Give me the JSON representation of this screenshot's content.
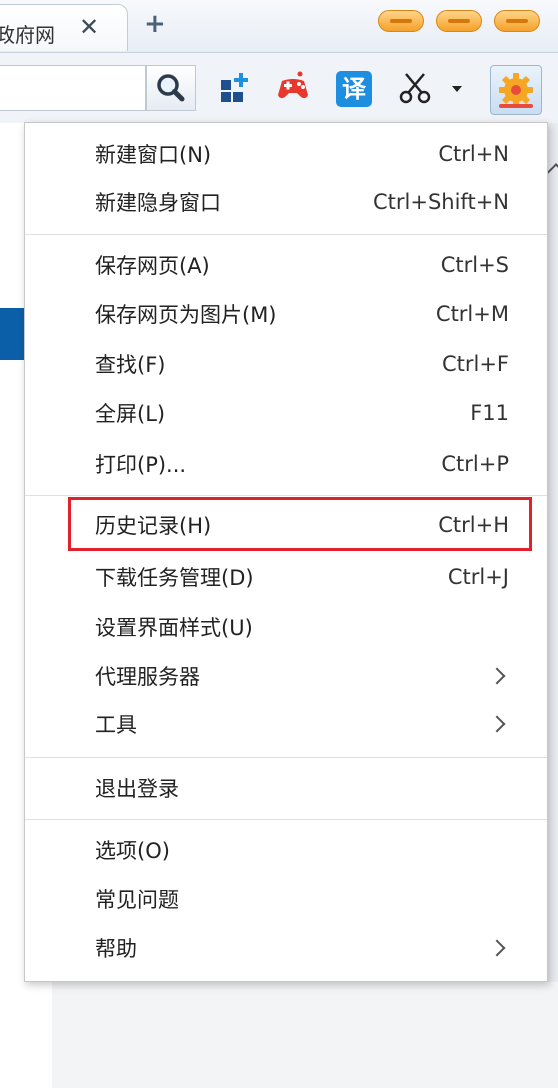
{
  "tab": {
    "title": "政府网",
    "close_glyph": "✕",
    "new_tab_glyph": "+"
  },
  "toolbar": {
    "icons": [
      "search-icon",
      "apps-icon",
      "game-icon",
      "translate-icon",
      "screenshot-icon",
      "settings-icon"
    ],
    "translate_label": "译",
    "dropdown_glyph": "▾"
  },
  "menu": {
    "items": [
      {
        "label": "新建窗口(N)",
        "shortcut": "Ctrl+N"
      },
      {
        "label": "新建隐身窗口",
        "shortcut": "Ctrl+Shift+N"
      },
      {
        "label": "保存网页(A)",
        "shortcut": "Ctrl+S"
      },
      {
        "label": "保存网页为图片(M)",
        "shortcut": "Ctrl+M"
      },
      {
        "label": "查找(F)",
        "shortcut": "Ctrl+F"
      },
      {
        "label": "全屏(L)",
        "shortcut": "F11"
      },
      {
        "label": "打印(P)...",
        "shortcut": "Ctrl+P"
      },
      {
        "label": "历史记录(H)",
        "shortcut": "Ctrl+H",
        "highlighted": true
      },
      {
        "label": "下载任务管理(D)",
        "shortcut": "Ctrl+J"
      },
      {
        "label": "设置界面样式(U)",
        "shortcut": ""
      },
      {
        "label": "代理服务器",
        "shortcut": "",
        "submenu": true
      },
      {
        "label": "工具",
        "shortcut": "",
        "submenu": true
      },
      {
        "label": "退出登录",
        "shortcut": ""
      },
      {
        "label": "选项(O)",
        "shortcut": ""
      },
      {
        "label": "常见问题",
        "shortcut": ""
      },
      {
        "label": "帮助",
        "shortcut": "",
        "submenu": true
      }
    ]
  },
  "colors": {
    "highlight_border": "#e0232a",
    "window_button": "#f5a12a",
    "translate_icon": "#1e8fe0",
    "page_accent": "#0b5fa8"
  }
}
